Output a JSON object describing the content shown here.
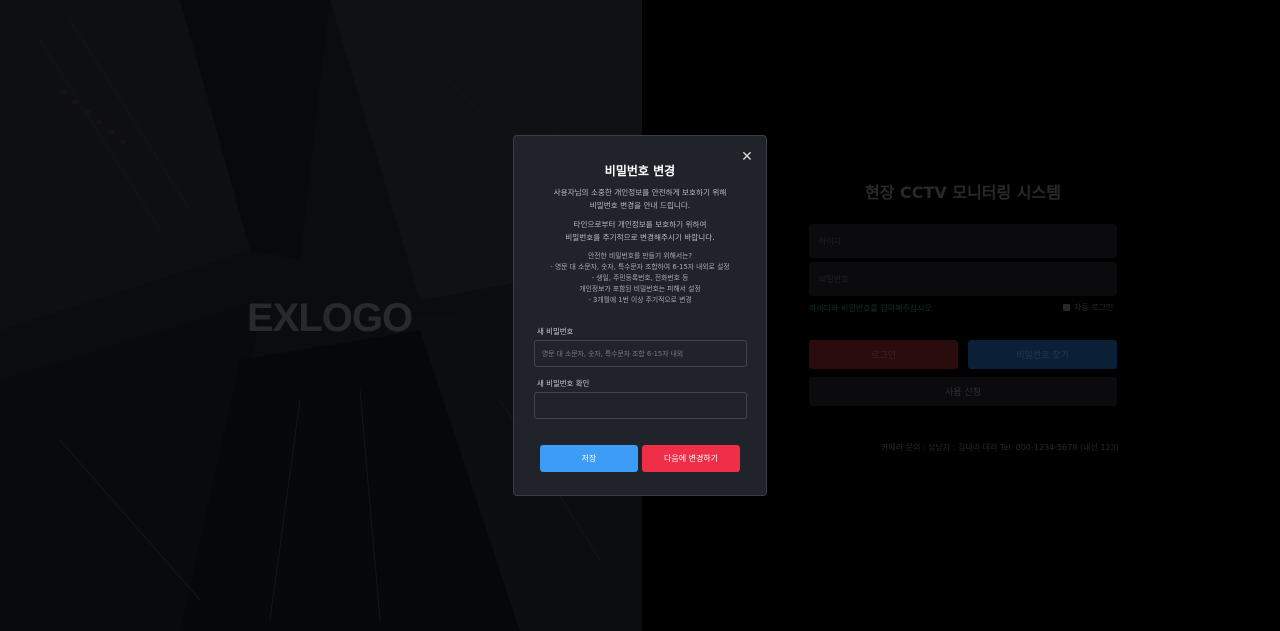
{
  "brand": {
    "logo_text": "EXLOGO"
  },
  "login": {
    "title": "현장 CCTV 모니터링 시스템",
    "id_placeholder": "아이디",
    "pw_placeholder": "비밀번호",
    "hint": "아이디와 비밀번호를 입력해주십시오",
    "auto_login_label": "자동 로그인",
    "login_button": "로그인",
    "find_password_button": "비밀번호 찾기",
    "signup_button": "사용 신청",
    "footer": "카메라 문의 : 담당자 : 김대리 대리 Tel. 000-1234-5678 (내선 123)"
  },
  "modal": {
    "close_icon": "close-icon",
    "title": "비밀번호 변경",
    "intro": "사용자님의 소중한 개인정보를 안전하게 보호하기 위해\n비밀번호 변경을 안내 드립니다.",
    "reason": "타인으로부터 개인정보를 보호하기 위하여\n비밀번호를 주기적으로 변경해주시기 바랍니다.",
    "tips": "안전한 비밀번호를 만들기 위해서는?\n- 영문 대 소문자, 숫자, 특수문자 조합하여 6-15자 내외로 설정\n- 생일, 주민등록번호, 전화번호 등\n개인정보가 포함된 비밀번호는 피해서 설정\n- 3개월에 1번 이상 주기적으로 변경",
    "new_password_label": "새 비밀번호",
    "new_password_placeholder": "영문 대 소문자, 숫자, 특수문자 조합 6-15자 내외",
    "confirm_password_label": "새 비밀번호 확인",
    "confirm_password_placeholder": "",
    "save_button": "저장",
    "later_button": "다음에 변경하기"
  },
  "colors": {
    "save_blue": "#3d9cf5",
    "later_red": "#ee2f47",
    "modal_bg": "#202329"
  }
}
